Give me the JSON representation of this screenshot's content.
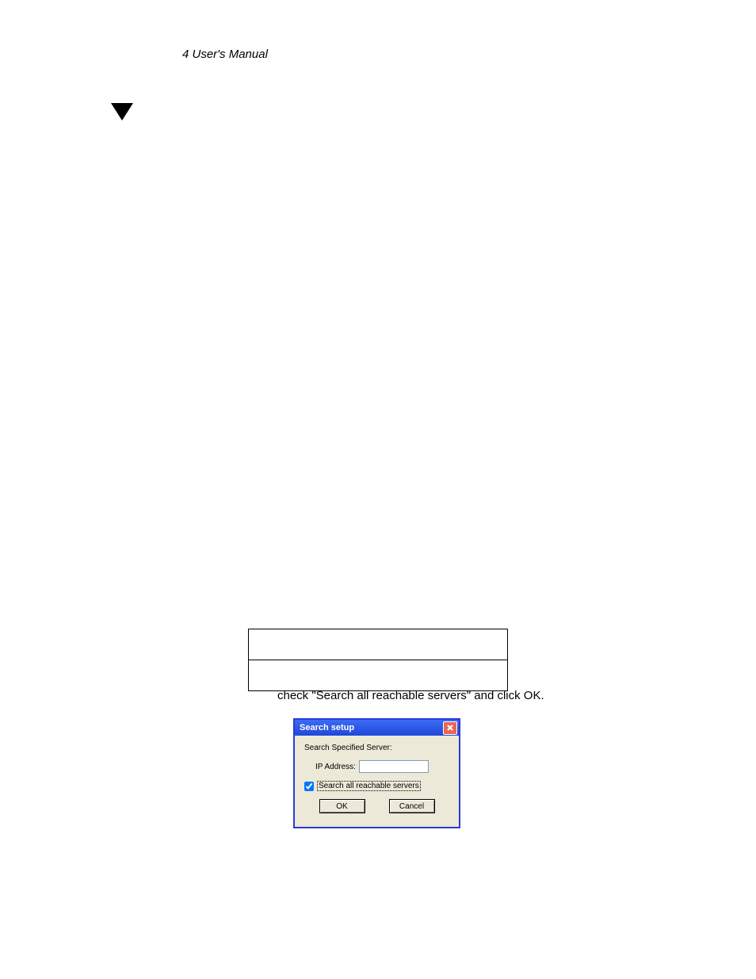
{
  "header": {
    "text": "4 User's Manual"
  },
  "caption": "check \"Search all reachable servers\" and click OK.",
  "dialog": {
    "title": "Search setup",
    "spec_label": "Search Specified Server:",
    "ip_label": "IP Address:",
    "ip_value": "",
    "checkbox_label": "Search all reachable servers",
    "checkbox_checked": true,
    "ok_label": "OK",
    "cancel_label": "Cancel"
  }
}
